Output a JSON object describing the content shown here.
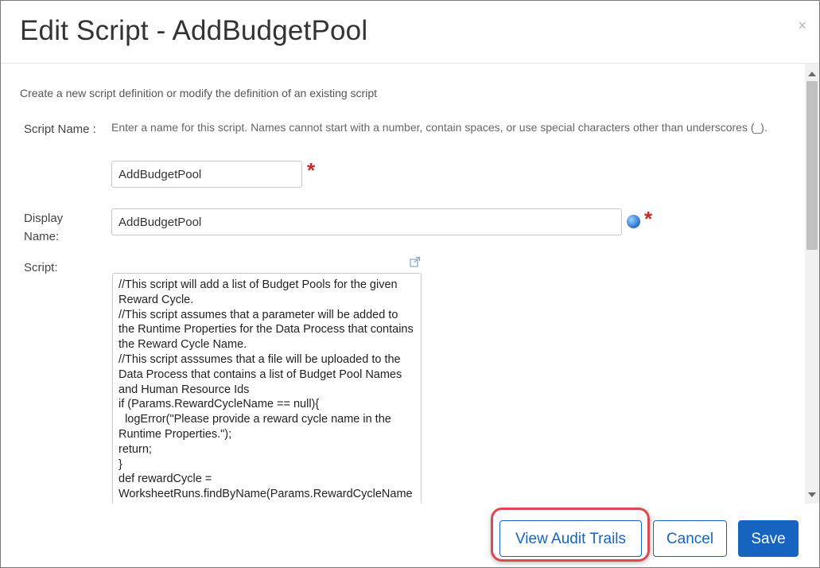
{
  "dialog": {
    "title": "Edit Script - AddBudgetPool",
    "close_glyph": "×",
    "description": "Create a new script definition or modify the definition of an existing script"
  },
  "form": {
    "script_name": {
      "label": "Script Name :",
      "help": "Enter a name for this script. Names cannot start with a number, contain spaces, or use special characters other than underscores (_).",
      "value": "AddBudgetPool",
      "required_mark": "*"
    },
    "display_name": {
      "label_line1": "Display",
      "label_line2": "Name:",
      "value": "AddBudgetPool",
      "required_mark": "*",
      "icon": "globe-icon"
    },
    "script": {
      "label": "Script:",
      "expand_icon": "expand-icon",
      "content": "//This script will add a list of Budget Pools for the given Reward Cycle.\n//This script assumes that a parameter will be added to the Runtime Properties for the Data Process that contains the Reward Cycle Name.\n//This script asssumes that a file will be uploaded to the Data Process that contains a list of Budget Pool Names and Human Resource Ids\nif (Params.RewardCycleName == null){\n  logError(\"Please provide a reward cycle name in the Runtime Properties.\");\nreturn;\n}\ndef rewardCycle = WorksheetRuns.findByName(Params.RewardCycleName);"
    }
  },
  "footer": {
    "audit_label": "View Audit Trails",
    "cancel_label": "Cancel",
    "save_label": "Save"
  },
  "colors": {
    "primary": "#1565c0",
    "required": "#c62828",
    "highlight": "#e0484f"
  }
}
